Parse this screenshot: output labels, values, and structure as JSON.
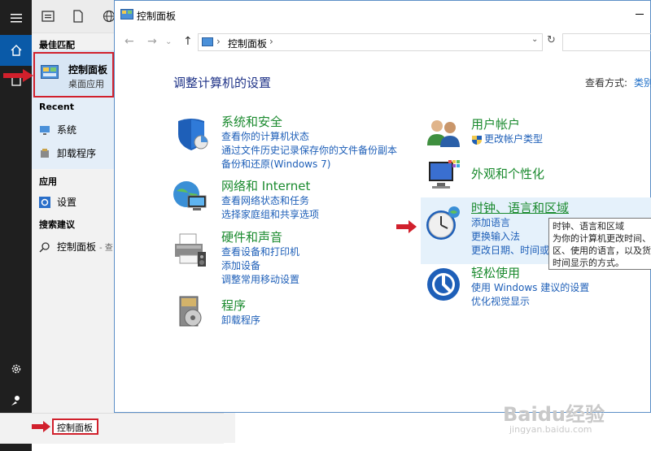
{
  "start_menu": {
    "best_match_header": "最佳匹配",
    "best_match": {
      "title": "控制面板",
      "subtitle": "桌面应用"
    },
    "recent_header": "Recent",
    "recent_items": [
      {
        "label": "系统"
      },
      {
        "label": "卸载程序"
      }
    ],
    "apps_header": "应用",
    "apps_items": [
      {
        "label": "设置"
      }
    ],
    "suggest_header": "搜索建议",
    "suggest_items": [
      {
        "label": "控制面板",
        "suffix": "- 查"
      }
    ],
    "search_value": "控制面板"
  },
  "window": {
    "title": "控制面板",
    "breadcrumb": "控制面板",
    "heading": "调整计算机的设置",
    "view_by_label": "查看方式:",
    "view_by_value": "类别",
    "left_categories": [
      {
        "title": "系统和安全",
        "icon": "shield-icon",
        "links": [
          "查看你的计算机状态",
          "通过文件历史记录保存你的文件备份副本",
          "备份和还原(Windows 7)"
        ]
      },
      {
        "title": "网络和 Internet",
        "icon": "network-icon",
        "links": [
          "查看网络状态和任务",
          "选择家庭组和共享选项"
        ]
      },
      {
        "title": "硬件和声音",
        "icon": "printer-icon",
        "links": [
          "查看设备和打印机",
          "添加设备",
          "调整常用移动设置"
        ]
      },
      {
        "title": "程序",
        "icon": "programs-icon",
        "links": [
          "卸载程序"
        ]
      }
    ],
    "right_categories": [
      {
        "title": "用户帐户",
        "icon": "users-icon",
        "links": [
          "更改帐户类型"
        ]
      },
      {
        "title": "外观和个性化",
        "icon": "appearance-icon",
        "links": []
      },
      {
        "title": "时钟、语言和区域",
        "icon": "clock-icon",
        "links": [
          "添加语言",
          "更换输入法",
          "更改日期、时间或"
        ]
      },
      {
        "title": "轻松使用",
        "icon": "ease-of-access-icon",
        "links": [
          "使用 Windows 建议的设置",
          "优化视觉显示"
        ]
      }
    ],
    "tooltip_lines": [
      "时钟、语言和区域",
      "为你的计算机更改时间、",
      "区、使用的语言，以及货",
      "时间显示的方式。"
    ]
  },
  "watermark": {
    "brand": "Baidu经验",
    "url": "jingyan.baidu.com"
  },
  "colors": {
    "accent_red": "#d1202c",
    "link_blue": "#1e5fb8",
    "category_green": "#1a8a2e",
    "heading_blue": "#1e3287"
  }
}
